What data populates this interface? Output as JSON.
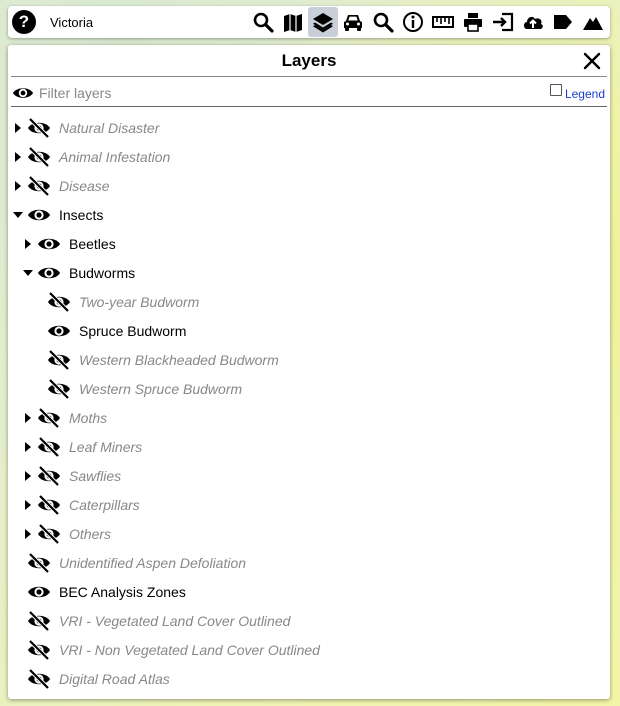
{
  "toolbar": {
    "help_label": "?",
    "location": "Victoria",
    "tools": [
      {
        "icon": "search-icon",
        "active": false
      },
      {
        "icon": "map-icon",
        "active": false
      },
      {
        "icon": "layers-icon",
        "active": true
      },
      {
        "icon": "car-icon",
        "active": false
      },
      {
        "icon": "search-icon",
        "active": false
      },
      {
        "icon": "info-icon",
        "active": false
      },
      {
        "icon": "ruler-icon",
        "active": false
      },
      {
        "icon": "print-icon",
        "active": false
      },
      {
        "icon": "sign-in-icon",
        "active": false
      },
      {
        "icon": "upload-icon",
        "active": false
      },
      {
        "icon": "tag-icon",
        "active": false
      },
      {
        "icon": "mountain-icon",
        "active": false
      }
    ]
  },
  "panel": {
    "title": "Layers",
    "filter_placeholder": "Filter layers",
    "legend_label": "Legend"
  },
  "layers": [
    {
      "label": "Natural Disaster",
      "visible": false,
      "caret": "right",
      "level": 0
    },
    {
      "label": "Animal Infestation",
      "visible": false,
      "caret": "right",
      "level": 0
    },
    {
      "label": "Disease",
      "visible": false,
      "caret": "right",
      "level": 0
    },
    {
      "label": "Insects",
      "visible": true,
      "caret": "down",
      "level": 0
    },
    {
      "label": "Beetles",
      "visible": true,
      "caret": "right",
      "level": 1
    },
    {
      "label": "Budworms",
      "visible": true,
      "caret": "down",
      "level": 1
    },
    {
      "label": "Two-year Budworm",
      "visible": false,
      "caret": "none",
      "level": 2
    },
    {
      "label": "Spruce Budworm",
      "visible": true,
      "caret": "none",
      "level": 2
    },
    {
      "label": "Western Blackheaded Budworm",
      "visible": false,
      "caret": "none",
      "level": 2
    },
    {
      "label": "Western Spruce Budworm",
      "visible": false,
      "caret": "none",
      "level": 2
    },
    {
      "label": "Moths",
      "visible": false,
      "caret": "right",
      "level": 1
    },
    {
      "label": "Leaf Miners",
      "visible": false,
      "caret": "right",
      "level": 1
    },
    {
      "label": "Sawflies",
      "visible": false,
      "caret": "right",
      "level": 1
    },
    {
      "label": "Caterpillars",
      "visible": false,
      "caret": "right",
      "level": 1
    },
    {
      "label": "Others",
      "visible": false,
      "caret": "right",
      "level": 1
    },
    {
      "label": "Unidentified Aspen Defoliation",
      "visible": false,
      "caret": "none",
      "level": 0
    },
    {
      "label": "BEC Analysis Zones",
      "visible": true,
      "caret": "none",
      "level": 0
    },
    {
      "label": "VRI - Vegetated Land Cover Outlined",
      "visible": false,
      "caret": "none",
      "level": 0
    },
    {
      "label": "VRI - Non Vegetated Land Cover Outlined",
      "visible": false,
      "caret": "none",
      "level": 0
    },
    {
      "label": "Digital Road Atlas",
      "visible": false,
      "caret": "none",
      "level": 0
    }
  ]
}
